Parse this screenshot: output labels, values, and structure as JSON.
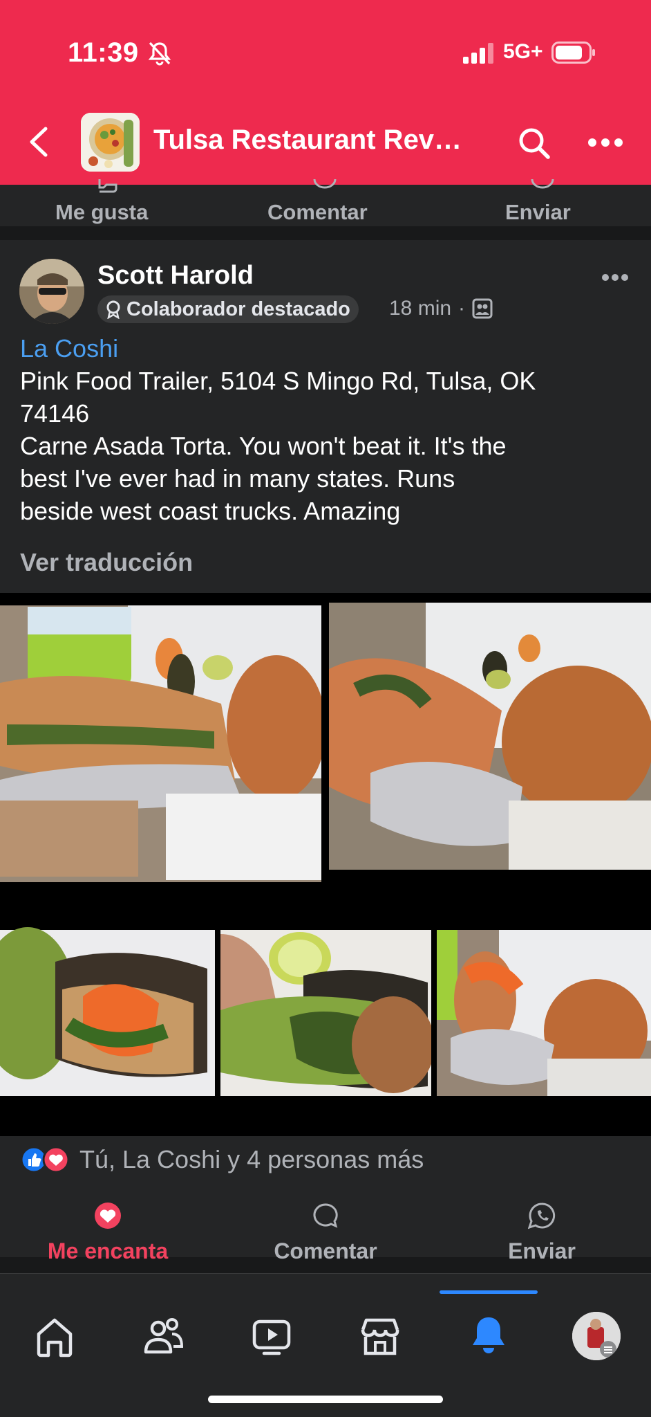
{
  "status_bar": {
    "time": "11:39",
    "network": "5G+"
  },
  "header": {
    "group_title": "Tulsa Restaurant Rev…",
    "icons": [
      "back-icon",
      "search-icon",
      "more-icon"
    ]
  },
  "previous_post_actions": {
    "like_label": "Me gusta",
    "comment_label": "Comentar",
    "send_label": "Enviar"
  },
  "post": {
    "author": "Scott Harold",
    "badge": "Colaborador destacado",
    "time": "18 min",
    "separator": "·",
    "text": {
      "place_link": "La Coshi",
      "line1": "Pink Food Trailer, 5104 S Mingo Rd, Tulsa, OK",
      "line2": "74146",
      "line3": "Carne Asada Torta.   You won't beat it.  It's the",
      "line4": "best I've ever had in many states.  Runs",
      "line5": "beside west coast trucks.  Amazing"
    },
    "translate_label": "Ver traducción",
    "reactions_summary": "Tú, La Coshi y 4 personas más",
    "actions": {
      "love_label": "Me encanta",
      "comment_label": "Comentar",
      "send_label": "Enviar"
    },
    "colors": {
      "love": "#f3425f",
      "link": "#4b9ff1",
      "header": "#ee2a4e"
    }
  },
  "bottom_nav": {
    "items": [
      "home-icon",
      "friends-icon",
      "video-icon",
      "marketplace-icon",
      "notifications-icon",
      "profile-avatar"
    ],
    "active": "notifications-icon"
  }
}
